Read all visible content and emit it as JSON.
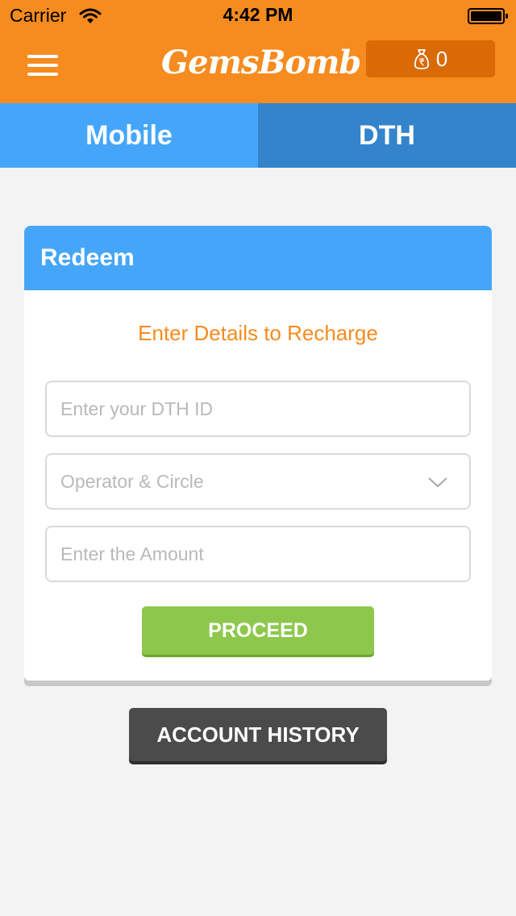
{
  "status_bar": {
    "carrier": "Carrier",
    "time": "4:42 PM",
    "icons": [
      "wifi-icon",
      "battery-icon"
    ]
  },
  "header": {
    "logo_text": "GemsBomb",
    "wallet_count": "0",
    "wallet_icon": "money-bag-icon",
    "menu_icon": "hamburger-menu-icon",
    "background_color": "#f68b1f",
    "wallet_color": "#d96a06"
  },
  "tabs": [
    {
      "label": "Mobile",
      "color": "#45a6f9"
    },
    {
      "label": "DTH",
      "color": "#3484cc"
    }
  ],
  "card": {
    "title": "Redeem",
    "subtitle": "Enter Details to Recharge",
    "dth_id": {
      "value": "",
      "placeholder": "Enter your DTH ID"
    },
    "operator": {
      "selected": "Operator & Circle"
    },
    "amount": {
      "value": "",
      "placeholder": "Enter the Amount"
    },
    "proceed_label": "PROCEED",
    "header_color": "#45a6f9",
    "subtitle_color": "#f68b1f",
    "proceed_color": "#8dc84c"
  },
  "account_history_label": "ACCOUNT HISTORY",
  "account_history_color": "#4b4b4b"
}
